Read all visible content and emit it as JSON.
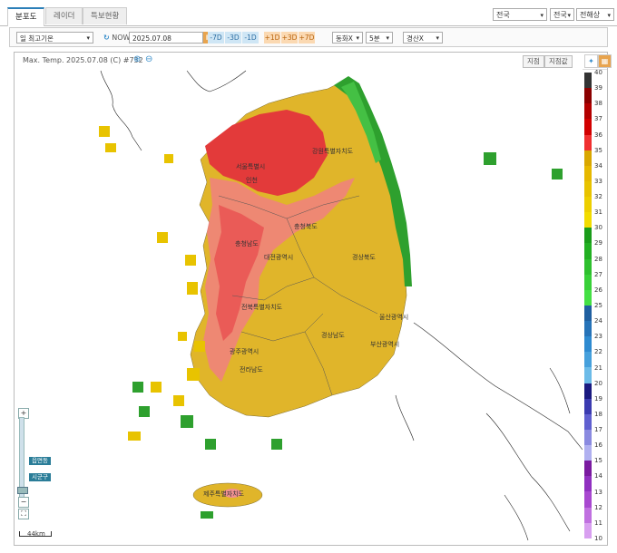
{
  "tabs": [
    {
      "label": "분포도",
      "active": true
    },
    {
      "label": "레이더",
      "active": false
    },
    {
      "label": "특보현황",
      "active": false
    }
  ],
  "top_selects": {
    "region1": "전국",
    "region2": "전국",
    "sea": "전해상"
  },
  "controls": {
    "element": "일 최고기온",
    "now_label": "NOW",
    "date": "2025.07.08",
    "nav_minus": [
      "-7D",
      "-3D",
      "-1D"
    ],
    "nav_plus": [
      "+1D",
      "+3D",
      "+7D"
    ],
    "composite": "동화X",
    "interval": "5분",
    "boundary": "경산X"
  },
  "panel": {
    "title": "Max. Temp. 2025.07.08 (C) #732",
    "btn_station": "지점",
    "btn_station_value": "지점값"
  },
  "map": {
    "labels": [
      {
        "name": "seoul",
        "text": "서울특별시"
      },
      {
        "name": "incheon",
        "text": "인천"
      },
      {
        "name": "gangwon",
        "text": "강원특별자치도"
      },
      {
        "name": "chungbuk",
        "text": "충청북도"
      },
      {
        "name": "chungnam",
        "text": "충청남도"
      },
      {
        "name": "daejeon",
        "text": "대전광역시"
      },
      {
        "name": "gyeongbuk",
        "text": "경상북도"
      },
      {
        "name": "jeonbuk",
        "text": "전북특별자치도"
      },
      {
        "name": "ulsan",
        "text": "울산광역시"
      },
      {
        "name": "gyeongnam",
        "text": "경상남도"
      },
      {
        "name": "busan",
        "text": "부산광역시"
      },
      {
        "name": "gwangju",
        "text": "광주광역시"
      },
      {
        "name": "jeonnam",
        "text": "전라남도"
      },
      {
        "name": "jeju",
        "text": "제주특별자치도"
      }
    ],
    "zoom_tags": [
      "읍면동",
      "시군구"
    ],
    "scale": "44km"
  },
  "legend": {
    "labels": [
      "40",
      "39",
      "38",
      "37",
      "36",
      "35",
      "34",
      "33",
      "32",
      "31",
      "30",
      "29",
      "28",
      "27",
      "26",
      "25",
      "24",
      "23",
      "22",
      "21",
      "20",
      "19",
      "18",
      "17",
      "16",
      "15",
      "14",
      "13",
      "12",
      "11",
      "10"
    ],
    "colors": [
      "#333333",
      "#8b0000",
      "#b30000",
      "#d20000",
      "#f03030",
      "#d9a700",
      "#e6b800",
      "#e8c300",
      "#edcf00",
      "#f2dc00",
      "#1a9c1a",
      "#22b022",
      "#2ec02e",
      "#38d038",
      "#44e044",
      "#1f5fa0",
      "#2673b8",
      "#2e8ad0",
      "#46a0dc",
      "#6cbbe8",
      "#1a1a80",
      "#3b3bb0",
      "#6060d0",
      "#8a8ae0",
      "#b0b0f0",
      "#7a1aa0",
      "#9030c0",
      "#a848d0",
      "#c070e0",
      "#d89ff0"
    ],
    "accent": "#2b7fb8"
  }
}
